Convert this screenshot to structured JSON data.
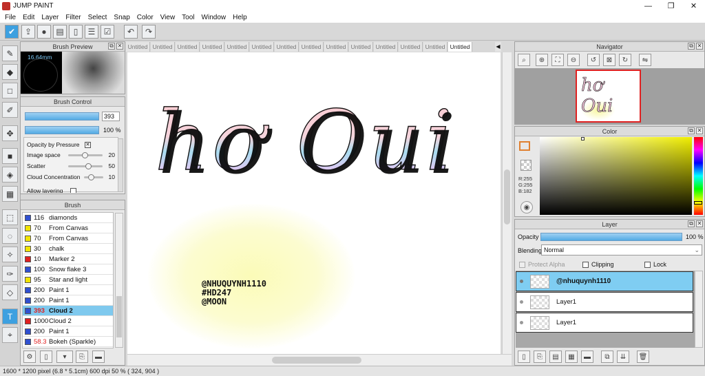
{
  "app": {
    "title": "JUMP PAINT"
  },
  "window_controls": {
    "minimize": "—",
    "maximize": "❐",
    "close": "✕"
  },
  "menu": [
    "File",
    "Edit",
    "Layer",
    "Filter",
    "Select",
    "Snap",
    "Color",
    "View",
    "Tool",
    "Window",
    "Help"
  ],
  "toolbar": {
    "icons": [
      "cloud-check-icon",
      "export-icon",
      "comment-icon",
      "message-icon",
      "page-icon",
      "page-list-icon",
      "checklist-icon",
      "undo-icon",
      "redo-icon"
    ]
  },
  "tools": [
    "brush-icon",
    "eraser-icon",
    "rect-icon",
    "pen-icon",
    "move-icon",
    "fill-rect-icon",
    "bucket-icon",
    "gradient-icon",
    "rect-select-icon",
    "lasso-icon",
    "magic-wand-icon",
    "select-pen-icon",
    "select-eraser-icon",
    "text-icon",
    "eyedropper-icon"
  ],
  "brush_preview": {
    "title": "Brush Preview",
    "size_label": "16.64mm"
  },
  "brush_control": {
    "title": "Brush Control",
    "size_value": "393",
    "opacity_value": "100 %",
    "opacity_by_pressure": "Opacity by Pressure",
    "params": [
      {
        "label": "Image space",
        "value": "20",
        "level": 0.4
      },
      {
        "label": "Scatter",
        "value": "50",
        "level": 0.5
      },
      {
        "label": "Cloud Concentration",
        "value": "10",
        "level": 0.2
      }
    ],
    "allow_layering": "Allow layering"
  },
  "brush_list": {
    "title": "Brush",
    "items": [
      {
        "num": "116",
        "name": "diamonds",
        "color": "#3050d0",
        "num_color": "#111"
      },
      {
        "num": "70",
        "name": "From Canvas",
        "color": "#f2e400",
        "num_color": "#111"
      },
      {
        "num": "70",
        "name": "From Canvas",
        "color": "#f2e400",
        "num_color": "#111"
      },
      {
        "num": "30",
        "name": "chalk",
        "color": "#f2e400",
        "num_color": "#111"
      },
      {
        "num": "10",
        "name": "Marker 2",
        "color": "#e02020",
        "num_color": "#111"
      },
      {
        "num": "100",
        "name": "Snow flake 3",
        "color": "#3050d0",
        "num_color": "#111"
      },
      {
        "num": "95",
        "name": "Star and light",
        "color": "#f2e400",
        "num_color": "#111"
      },
      {
        "num": "200",
        "name": "Paint 1",
        "color": "#3050d0",
        "num_color": "#111"
      },
      {
        "num": "200",
        "name": "Paint 1",
        "color": "#3050d0",
        "num_color": "#111"
      },
      {
        "num": "393",
        "name": "Cloud 2",
        "color": "#3050d0",
        "num_color": "#e02020"
      },
      {
        "num": "1000",
        "name": "Cloud 2",
        "color": "#e02020",
        "num_color": "#111"
      },
      {
        "num": "200",
        "name": "Paint 1",
        "color": "#3050d0",
        "num_color": "#111"
      },
      {
        "num": "58.3",
        "name": "Bokeh (Sparkle)",
        "color": "#3050d0",
        "num_color": "#e02020"
      }
    ],
    "selected_index": 9
  },
  "tabs": [
    "Untitled",
    "Untitled",
    "Untitled",
    "Untitled",
    "Untitled",
    "Untitled",
    "Untitled",
    "Untitled",
    "Untitled",
    "Untitled",
    "Untitled",
    "Untitled",
    "Untitled",
    "Untitled"
  ],
  "canvas": {
    "title_text": "hơ Oui",
    "watermark": [
      "@NHUQUYNH1110",
      "#HD247",
      "@MOON"
    ]
  },
  "navigator": {
    "title": "Navigator",
    "thumb_text": "hơ Oui"
  },
  "color_panel": {
    "title": "Color",
    "rgb": [
      "R:255",
      "G:255",
      "B:182"
    ],
    "current": "#ffffb6"
  },
  "layer_panel": {
    "title": "Layer",
    "opacity_label": "Opacity",
    "opacity_value": "100 %",
    "blending_label": "Blending",
    "blending_value": "Normal",
    "protect_alpha": "Protect Alpha",
    "clipping": "Clipping",
    "lock": "Lock",
    "layers": [
      {
        "name": "@nhuquynh1110",
        "selected": true
      },
      {
        "name": "Layer1",
        "selected": false
      },
      {
        "name": "Layer1",
        "selected": false
      }
    ]
  },
  "status": {
    "text": "1600 * 1200 pixel   (6.8 * 5.1cm)   600 dpi   50 %   ( 324, 904 )"
  }
}
